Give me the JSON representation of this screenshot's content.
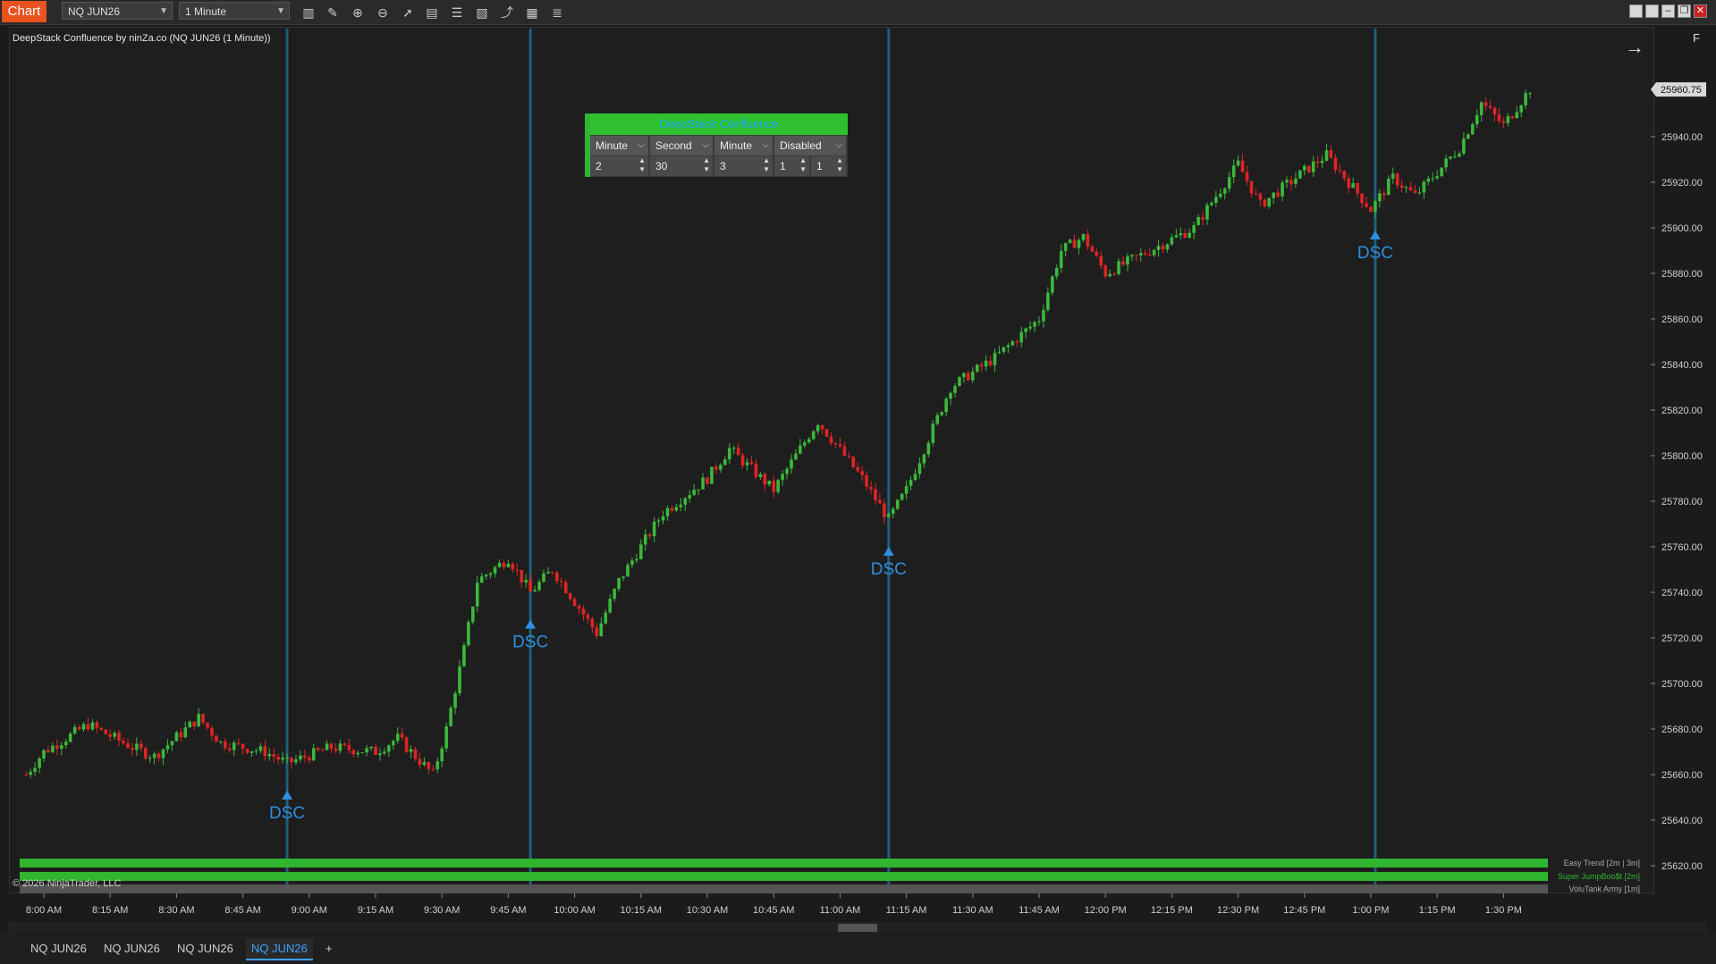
{
  "toolbar": {
    "chart_label": "Chart",
    "instrument": "NQ JUN26",
    "interval": "1 Minute"
  },
  "chart": {
    "title": "DeepStack Confluence by ninZa.co (NQ JUN26 (1 Minute))",
    "copyright": "© 2026 NinjaTrader, LLC",
    "last_price": "25960.75",
    "y_ticks": [
      "25940.00",
      "25920.00",
      "25900.00",
      "25880.00",
      "25860.00",
      "25840.00",
      "25820.00",
      "25800.00",
      "25780.00",
      "25760.00",
      "25740.00",
      "25720.00",
      "25700.00",
      "25680.00",
      "25660.00",
      "25640.00",
      "25620.00"
    ],
    "x_ticks": [
      "8:00 AM",
      "8:15 AM",
      "8:30 AM",
      "8:45 AM",
      "9:00 AM",
      "9:15 AM",
      "9:30 AM",
      "9:45 AM",
      "10:00 AM",
      "10:15 AM",
      "10:30 AM",
      "10:45 AM",
      "11:00 AM",
      "11:15 AM",
      "11:30 AM",
      "11:45 AM",
      "12:00 PM",
      "12:15 PM",
      "12:30 PM",
      "12:45 PM",
      "1:00 PM",
      "1:15 PM",
      "1:30 PM"
    ],
    "signal_label": "DSC",
    "signal_times": [
      "8:55 AM",
      "9:50 AM",
      "11:11 AM",
      "1:01 PM"
    ],
    "indicator_labels": [
      "Easy Trend [2m | 3m]",
      "Super JumpBoo$t [2m]",
      "VoluTank Army [1m]"
    ],
    "colors": {
      "up": "#3bb83b",
      "down": "#e02424",
      "signal": "#2f8fdf",
      "vline": "#1f5f7a"
    }
  },
  "chart_data": {
    "type": "candlestick",
    "title": "DeepStack Confluence by ninZa.co (NQ JUN26 (1 Minute))",
    "ylim": [
      25620,
      25960
    ],
    "x_range": [
      "8:00 AM",
      "1:30 PM"
    ],
    "series": [
      {
        "x": "7:56 AM",
        "y": 25660
      },
      {
        "x": "8:00 AM",
        "y": 25670
      },
      {
        "x": "8:10 AM",
        "y": 25682
      },
      {
        "x": "8:20 AM",
        "y": 25672
      },
      {
        "x": "8:25 AM",
        "y": 25668
      },
      {
        "x": "8:35 AM",
        "y": 25685
      },
      {
        "x": "8:40 AM",
        "y": 25674
      },
      {
        "x": "8:50 AM",
        "y": 25670
      },
      {
        "x": "8:55 AM",
        "y": 25665
      },
      {
        "x": "9:05 AM",
        "y": 25672
      },
      {
        "x": "9:15 AM",
        "y": 25670
      },
      {
        "x": "9:20 AM",
        "y": 25676
      },
      {
        "x": "9:28 AM",
        "y": 25660
      },
      {
        "x": "9:31 AM",
        "y": 25680
      },
      {
        "x": "9:35 AM",
        "y": 25715
      },
      {
        "x": "9:38 AM",
        "y": 25745
      },
      {
        "x": "9:45 AM",
        "y": 25755
      },
      {
        "x": "9:50 AM",
        "y": 25740
      },
      {
        "x": "9:55 AM",
        "y": 25750
      },
      {
        "x": "10:05 AM",
        "y": 25722
      },
      {
        "x": "10:10 AM",
        "y": 25745
      },
      {
        "x": "10:20 AM",
        "y": 25775
      },
      {
        "x": "10:30 AM",
        "y": 25790
      },
      {
        "x": "10:35 AM",
        "y": 25803
      },
      {
        "x": "10:45 AM",
        "y": 25785
      },
      {
        "x": "10:55 AM",
        "y": 25815
      },
      {
        "x": "11:05 AM",
        "y": 25790
      },
      {
        "x": "11:11 AM",
        "y": 25772
      },
      {
        "x": "11:15 AM",
        "y": 25785
      },
      {
        "x": "11:25 AM",
        "y": 25830
      },
      {
        "x": "11:35 AM",
        "y": 25843
      },
      {
        "x": "11:45 AM",
        "y": 25860
      },
      {
        "x": "11:50 AM",
        "y": 25890
      },
      {
        "x": "11:55 AM",
        "y": 25896
      },
      {
        "x": "12:00 PM",
        "y": 25880
      },
      {
        "x": "12:10 PM",
        "y": 25890
      },
      {
        "x": "12:20 PM",
        "y": 25900
      },
      {
        "x": "12:30 PM",
        "y": 25928
      },
      {
        "x": "12:35 PM",
        "y": 25910
      },
      {
        "x": "12:45 PM",
        "y": 25925
      },
      {
        "x": "12:50 PM",
        "y": 25932
      },
      {
        "x": "1:00 PM",
        "y": 25908
      },
      {
        "x": "1:05 PM",
        "y": 25922
      },
      {
        "x": "1:10 PM",
        "y": 25914
      },
      {
        "x": "1:20 PM",
        "y": 25935
      },
      {
        "x": "1:25 PM",
        "y": 25955
      },
      {
        "x": "1:30 PM",
        "y": 25945
      },
      {
        "x": "1:36 PM",
        "y": 25961
      }
    ]
  },
  "dsc_panel": {
    "title": "DeepStack Confluence",
    "headers": [
      "Minute",
      "Second",
      "Minute",
      "Disabled"
    ],
    "values": [
      "2",
      "30",
      "3",
      "1",
      "1"
    ]
  },
  "bottom_tabs": [
    "NQ JUN26",
    "NQ JUN26",
    "NQ JUN26",
    "NQ JUN26"
  ],
  "add_tab": "+",
  "icons": {
    "right_arrow": "→",
    "f_label": "F"
  }
}
